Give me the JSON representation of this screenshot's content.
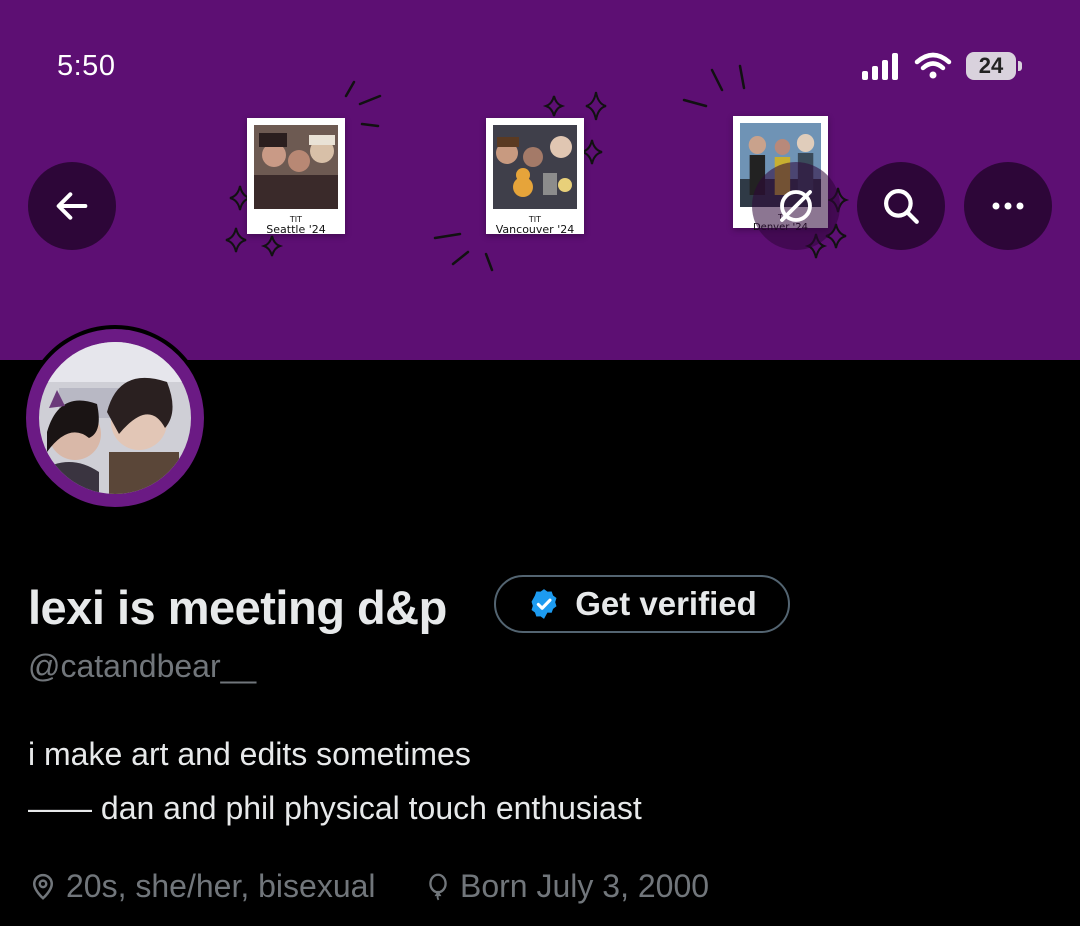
{
  "status_bar": {
    "time": "5:50",
    "battery_level": "24"
  },
  "header": {
    "banner_color": "#5d0f73",
    "back_icon": "arrow-left-icon",
    "search_icon": "search-icon",
    "more_icon": "more-horizontal-icon",
    "grok_icon": "grok-icon"
  },
  "banner": {
    "polaroids": [
      {
        "caption_top": "TIT",
        "caption": "Seattle '24"
      },
      {
        "caption_top": "TIT",
        "caption": "Vancouver '24"
      },
      {
        "caption_top": "T",
        "caption": "Denver '24"
      }
    ]
  },
  "profile": {
    "display_name": "lexi is meeting d&p",
    "get_verified_label": "Get verified",
    "verified_badge_color": "#1d9bf0",
    "handle": "@catandbear__",
    "bio_line1": "i make art and edits sometimes",
    "bio_line2": "—— dan and phil physical touch enthusiast",
    "location": "20s, she/her, bisexual",
    "birthday": "Born July 3, 2000"
  }
}
